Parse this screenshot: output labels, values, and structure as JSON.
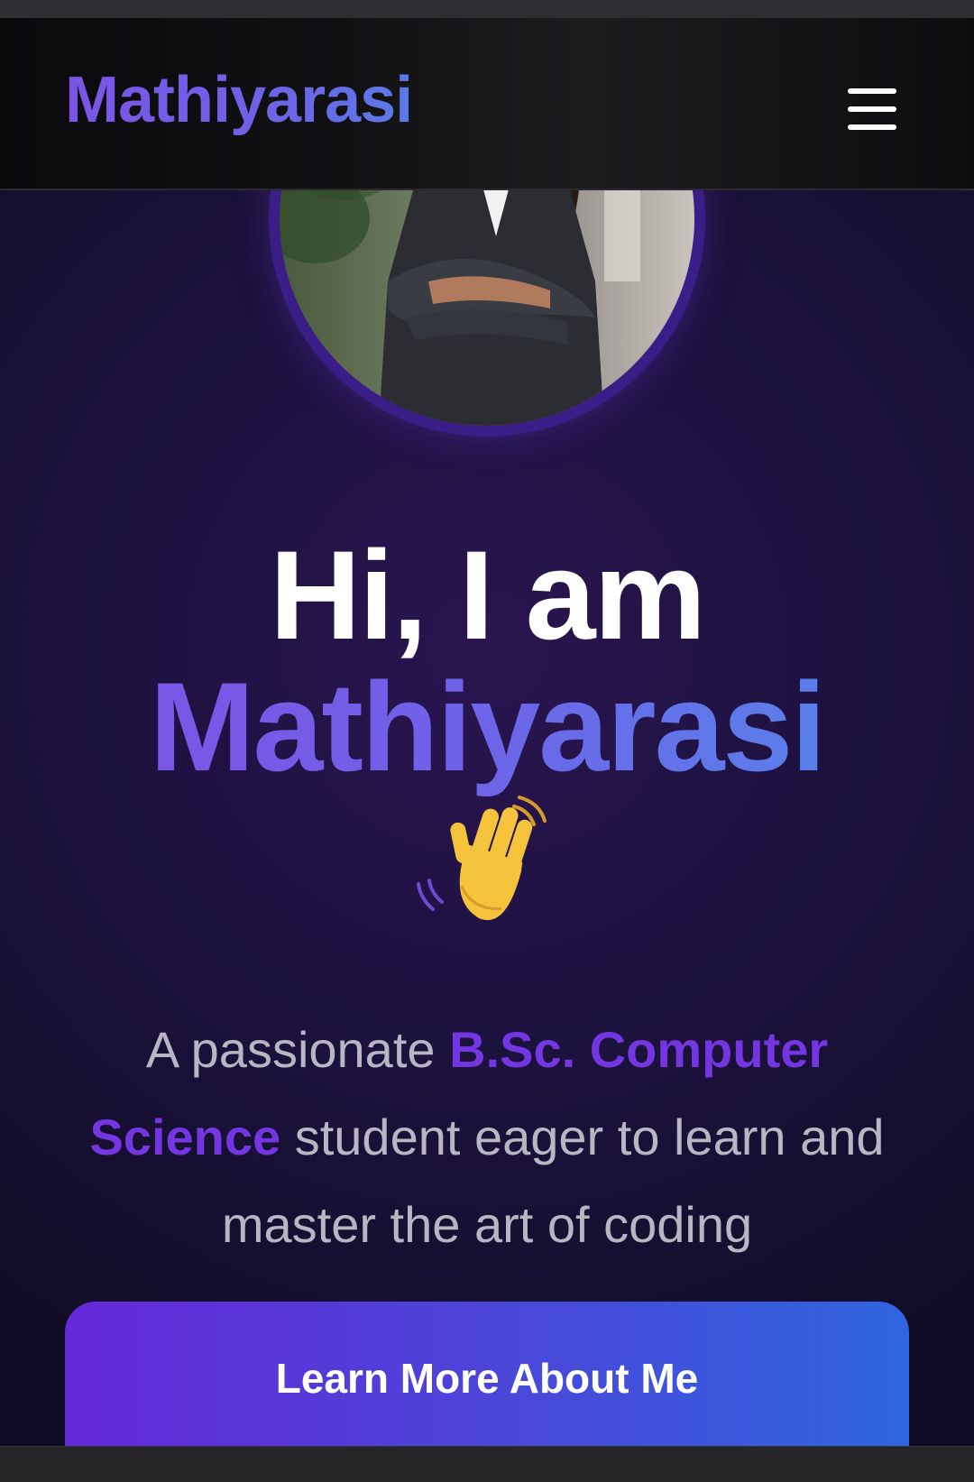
{
  "navbar": {
    "brand": "Mathiyarasi",
    "menu_icon": "hamburger-menu-icon"
  },
  "hero": {
    "avatar_alt": "Profile photo",
    "greeting": "Hi, I am",
    "name": "Mathiyarasi",
    "wave_icon": "waving-hand-icon",
    "tagline_before": "A passionate ",
    "tagline_highlight": "B.Sc. Computer Science",
    "tagline_after": " student eager to learn and master the art of coding",
    "cta_label": "Learn More About Me"
  },
  "colors": {
    "background": "#1d1240",
    "accent_purple": "#7436e0",
    "gradient_start": "#7b55e6",
    "gradient_end": "#5a80ea",
    "button_start": "#6428d8",
    "button_end": "#2f65e0"
  }
}
